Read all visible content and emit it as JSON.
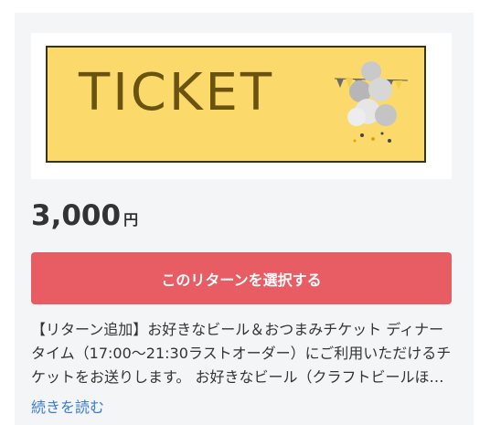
{
  "reward": {
    "image_text": "TICKET",
    "price_value": "3,000",
    "price_unit": "円",
    "select_button_label": "このリターンを選択する",
    "description": "【リターン追加】お好きなビール＆おつまみチケット ディナータイム（17:00〜21:30ラストオーダー）にご利用いただけるチケットをお送りします。 お好きなビール（クラフトビールほか）とおつまみをお楽しみいただけます。",
    "read_more_label": "続きを読む"
  },
  "colors": {
    "ticket_background": "#fbd96b",
    "ticket_text": "#6a5310",
    "button": "#e85c64",
    "link": "#3a7bd5"
  }
}
